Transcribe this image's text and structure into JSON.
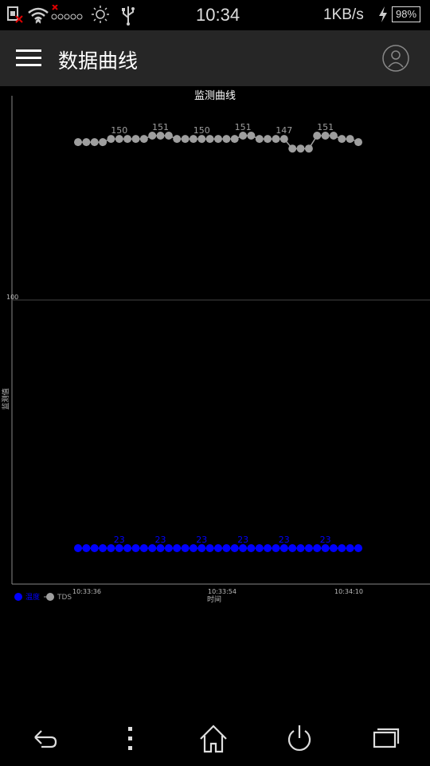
{
  "status_bar": {
    "time": "10:34",
    "speed": "1KB/s",
    "battery": "98%",
    "icons": [
      "sim-error-icon",
      "wifi-icon",
      "signal-icon",
      "brightness-icon",
      "usb-icon",
      "charging-icon",
      "battery-icon"
    ]
  },
  "app_bar": {
    "title": "数据曲线",
    "menu_icon": "hamburger-menu-icon",
    "avatar_icon": "user-avatar-icon"
  },
  "chart_data": {
    "type": "line",
    "title": "监测曲线",
    "xlabel": "时间",
    "ylabel": "监测值",
    "y_tick_labels": [
      "100"
    ],
    "x_tick_labels": [
      "10:33:36",
      "10:33:54",
      "10:34:10"
    ],
    "legend_position": "bottom-left",
    "series": [
      {
        "name": "温度",
        "color": "#0000ff",
        "values": [
          23,
          23,
          23,
          23,
          23,
          23,
          23,
          23,
          23,
          23,
          23,
          23,
          23,
          23,
          23,
          23,
          23,
          23,
          23,
          23,
          23,
          23,
          23,
          23,
          23,
          23,
          23,
          23,
          23,
          23,
          23,
          23,
          23,
          23,
          23
        ],
        "value_labels": [
          "23",
          "23",
          "23",
          "23",
          "23",
          "23"
        ]
      },
      {
        "name": "TDS",
        "color": "#9e9e9e",
        "values": [
          149,
          149,
          149,
          149,
          150,
          150,
          150,
          150,
          150,
          151,
          151,
          151,
          150,
          150,
          150,
          150,
          150,
          150,
          150,
          150,
          151,
          151,
          150,
          150,
          150,
          150,
          147,
          147,
          147,
          151,
          151,
          151,
          150,
          150,
          149
        ],
        "value_labels": [
          "150",
          "151",
          "150",
          "151",
          "147",
          "151"
        ]
      }
    ]
  },
  "nav_bar": {
    "icons": [
      "back-icon",
      "overflow-menu-icon",
      "home-icon",
      "power-icon",
      "recent-apps-icon"
    ]
  }
}
